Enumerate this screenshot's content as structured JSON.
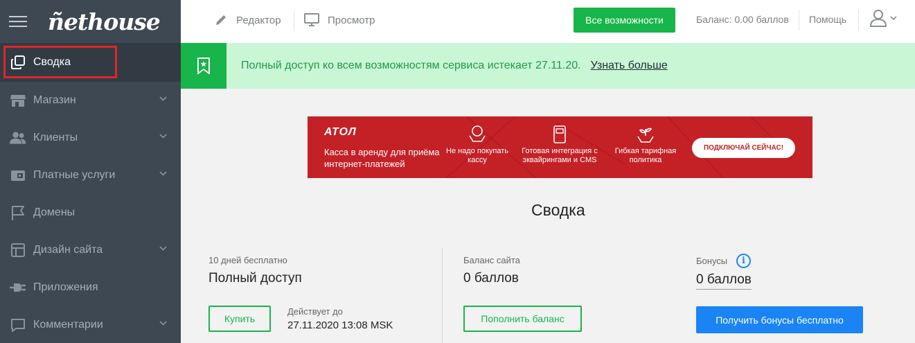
{
  "sidebar": {
    "logo": "ñethouse",
    "items": [
      {
        "label": "Сводка",
        "icon": "copy-icon"
      },
      {
        "label": "Магазин",
        "icon": "store-icon"
      },
      {
        "label": "Клиенты",
        "icon": "users-icon"
      },
      {
        "label": "Платные услуги",
        "icon": "wallet-icon"
      },
      {
        "label": "Домены",
        "icon": "flag-icon"
      },
      {
        "label": "Дизайн сайта",
        "icon": "layout-icon"
      },
      {
        "label": "Приложения",
        "icon": "plug-icon"
      },
      {
        "label": "Комментарии",
        "icon": "comment-icon"
      }
    ]
  },
  "header": {
    "editor": "Редактор",
    "preview": "Просмотр",
    "features": "Все возможности",
    "balance": "Баланс: 0.00 баллов",
    "help": "Помощь"
  },
  "notice": {
    "text": "Полный доступ ко всем возможностям сервиса истекает 27.11.20.",
    "link": "Узнать больше"
  },
  "banner": {
    "logo": "АТОЛ",
    "tagline": "Касса в аренду для приёма интернет-платежей",
    "features": [
      "Не надо покупать кассу",
      "Готовая интеграция с эквайрингами и CMS",
      "Гибкая тарифная политика"
    ],
    "cta": "ПОДКЛЮЧАЙ СЕЙЧАС!"
  },
  "summary": {
    "title": "Сводка",
    "access": {
      "label": "10 дней бесплатно",
      "value": "Полный доступ",
      "buy": "Купить",
      "valid_label": "Действует до",
      "valid_value": "27.11.2020 13:08 MSK"
    },
    "balance": {
      "label": "Баланс сайта",
      "value": "0 баллов",
      "button": "Пополнить баланс"
    },
    "bonus": {
      "label": "Бонусы",
      "value": "0 баллов",
      "button": "Получить бонусы бесплатно"
    }
  },
  "colors": {
    "sidebar": "#3d4852",
    "accent_green": "#17b54a",
    "notice_bg": "#c9f7d6",
    "banner_red": "#c42127",
    "blue": "#1a84f5"
  }
}
